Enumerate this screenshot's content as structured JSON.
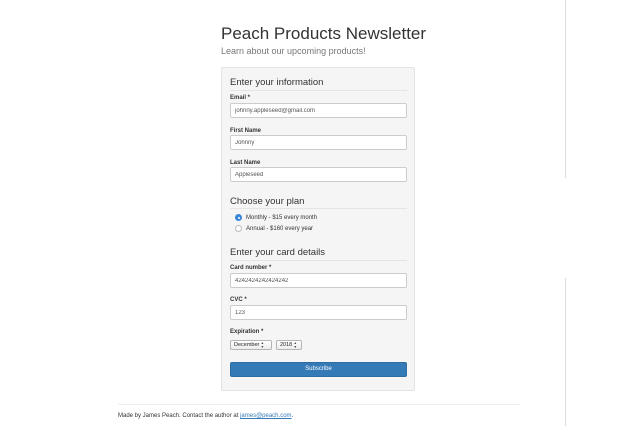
{
  "header": {
    "title": "Peach Products Newsletter",
    "subtitle": "Learn about our upcoming products!"
  },
  "info_section": {
    "heading": "Enter your information",
    "email": {
      "label": "Email *",
      "value": "johnny.appleseed@gmail.com"
    },
    "first_name": {
      "label": "First Name",
      "value": "Johnny"
    },
    "last_name": {
      "label": "Last Name",
      "value": "Appleseed"
    }
  },
  "plan_section": {
    "heading": "Choose your plan",
    "options": [
      {
        "label": "Monthly - $15 every month",
        "checked": true
      },
      {
        "label": "Annual - $160 every year",
        "checked": false
      }
    ]
  },
  "card_section": {
    "heading": "Enter your card details",
    "card_number": {
      "label": "Card number *",
      "value": "4242424242424242"
    },
    "cvc": {
      "label": "CVC *",
      "value": "123"
    },
    "expiration": {
      "label": "Expiration *",
      "month": "December",
      "year": "2018"
    }
  },
  "subscribe_label": "Subscribe",
  "footer": {
    "text": "Made by James Peach. Contact the author at ",
    "email": "james@peach.com",
    "suffix": "."
  },
  "colors": {
    "primary": "#337ab7",
    "panel_bg": "#f5f5f5",
    "radio_checked": "#3a86d8"
  },
  "icons": [
    "select-arrows-icon",
    "radio-checked-icon",
    "radio-unchecked-icon"
  ]
}
